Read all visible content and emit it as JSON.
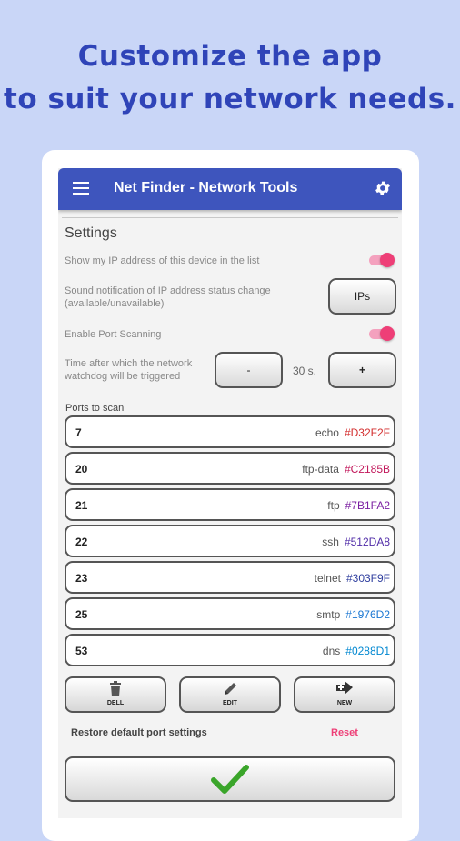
{
  "headline": {
    "line1": "Customize the app",
    "line2": "to suit your network needs."
  },
  "appbar": {
    "title": "Net Finder - Network Tools"
  },
  "settings": {
    "title": "Settings",
    "show_ip_label": "Show my IP address of this device in the list",
    "show_ip_enabled": true,
    "sound_label_1": "Sound notification of IP address status change",
    "sound_label_2": "(available/unavailable)",
    "sound_button": "IPs",
    "port_scan_label": "Enable Port Scanning",
    "port_scan_enabled": true,
    "watchdog_label_1": "Time after which the network",
    "watchdog_label_2": "watchdog will be triggered",
    "minus_label": "-",
    "plus_label": "+",
    "watchdog_value": "30 s."
  },
  "ports": {
    "title": "Ports to scan",
    "items": [
      {
        "port": "7",
        "service": "echo",
        "color": "#D32F2F"
      },
      {
        "port": "20",
        "service": "ftp-data",
        "color": "#C2185B"
      },
      {
        "port": "21",
        "service": "ftp",
        "color": "#7B1FA2"
      },
      {
        "port": "22",
        "service": "ssh",
        "color": "#512DA8"
      },
      {
        "port": "23",
        "service": "telnet",
        "color": "#303F9F"
      },
      {
        "port": "25",
        "service": "smtp",
        "color": "#1976D2"
      },
      {
        "port": "53",
        "service": "dns",
        "color": "#0288D1"
      }
    ]
  },
  "actions": {
    "delete": "DELL",
    "edit": "EDIT",
    "new": "NEW"
  },
  "restore": {
    "label": "Restore default port settings",
    "reset": "Reset"
  },
  "colors": {
    "accent": "#ee3f77",
    "appbar": "#3e55bd",
    "headline": "#2f44b8",
    "check": "#3aa52a"
  }
}
